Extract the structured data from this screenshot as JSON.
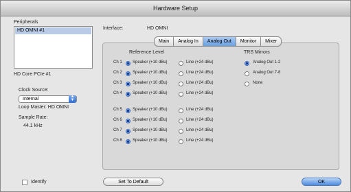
{
  "window": {
    "title": "Hardware Setup"
  },
  "sidebar": {
    "peripherals_label": "Peripherals",
    "peripherals": [
      "HD OMNI #1"
    ],
    "device_label": "HD Core PCIe #1",
    "clock_source_label": "Clock Source:",
    "clock_source_value": "Internal",
    "loop_master": "Loop Master: HD OMNI",
    "sample_rate_label": "Sample Rate:",
    "sample_rate_value": "44.1 kHz",
    "identify_label": "Identify"
  },
  "interface": {
    "label": "Interface:",
    "value": "HD OMNI"
  },
  "tabs": [
    "Main",
    "Analog In",
    "Analog Out",
    "Monitor",
    "Mixer"
  ],
  "active_tab": "Analog Out",
  "reference_level": {
    "heading": "Reference Level",
    "speaker_label": "Speaker (+10 dBu)",
    "line_label": "Line (+24 dBu)",
    "channels": [
      {
        "name": "Ch 1",
        "selected": "speaker"
      },
      {
        "name": "Ch 2",
        "selected": "speaker"
      },
      {
        "name": "Ch 3",
        "selected": "speaker"
      },
      {
        "name": "Ch 4",
        "selected": "speaker"
      },
      {
        "name": "Ch 5",
        "selected": "speaker"
      },
      {
        "name": "Ch 6",
        "selected": "speaker"
      },
      {
        "name": "Ch 7",
        "selected": "speaker"
      },
      {
        "name": "Ch 8",
        "selected": "speaker"
      }
    ]
  },
  "trs_mirrors": {
    "heading": "TRS Mirrors",
    "options": [
      "Analog Out 1-2",
      "Analog Out 7-8",
      "None"
    ],
    "selected": "Analog Out 1-2"
  },
  "buttons": {
    "set_default": "Set To Default",
    "ok": "OK"
  },
  "colors": {
    "accent": "#5e93dd",
    "selection": "#b9cbe6"
  }
}
